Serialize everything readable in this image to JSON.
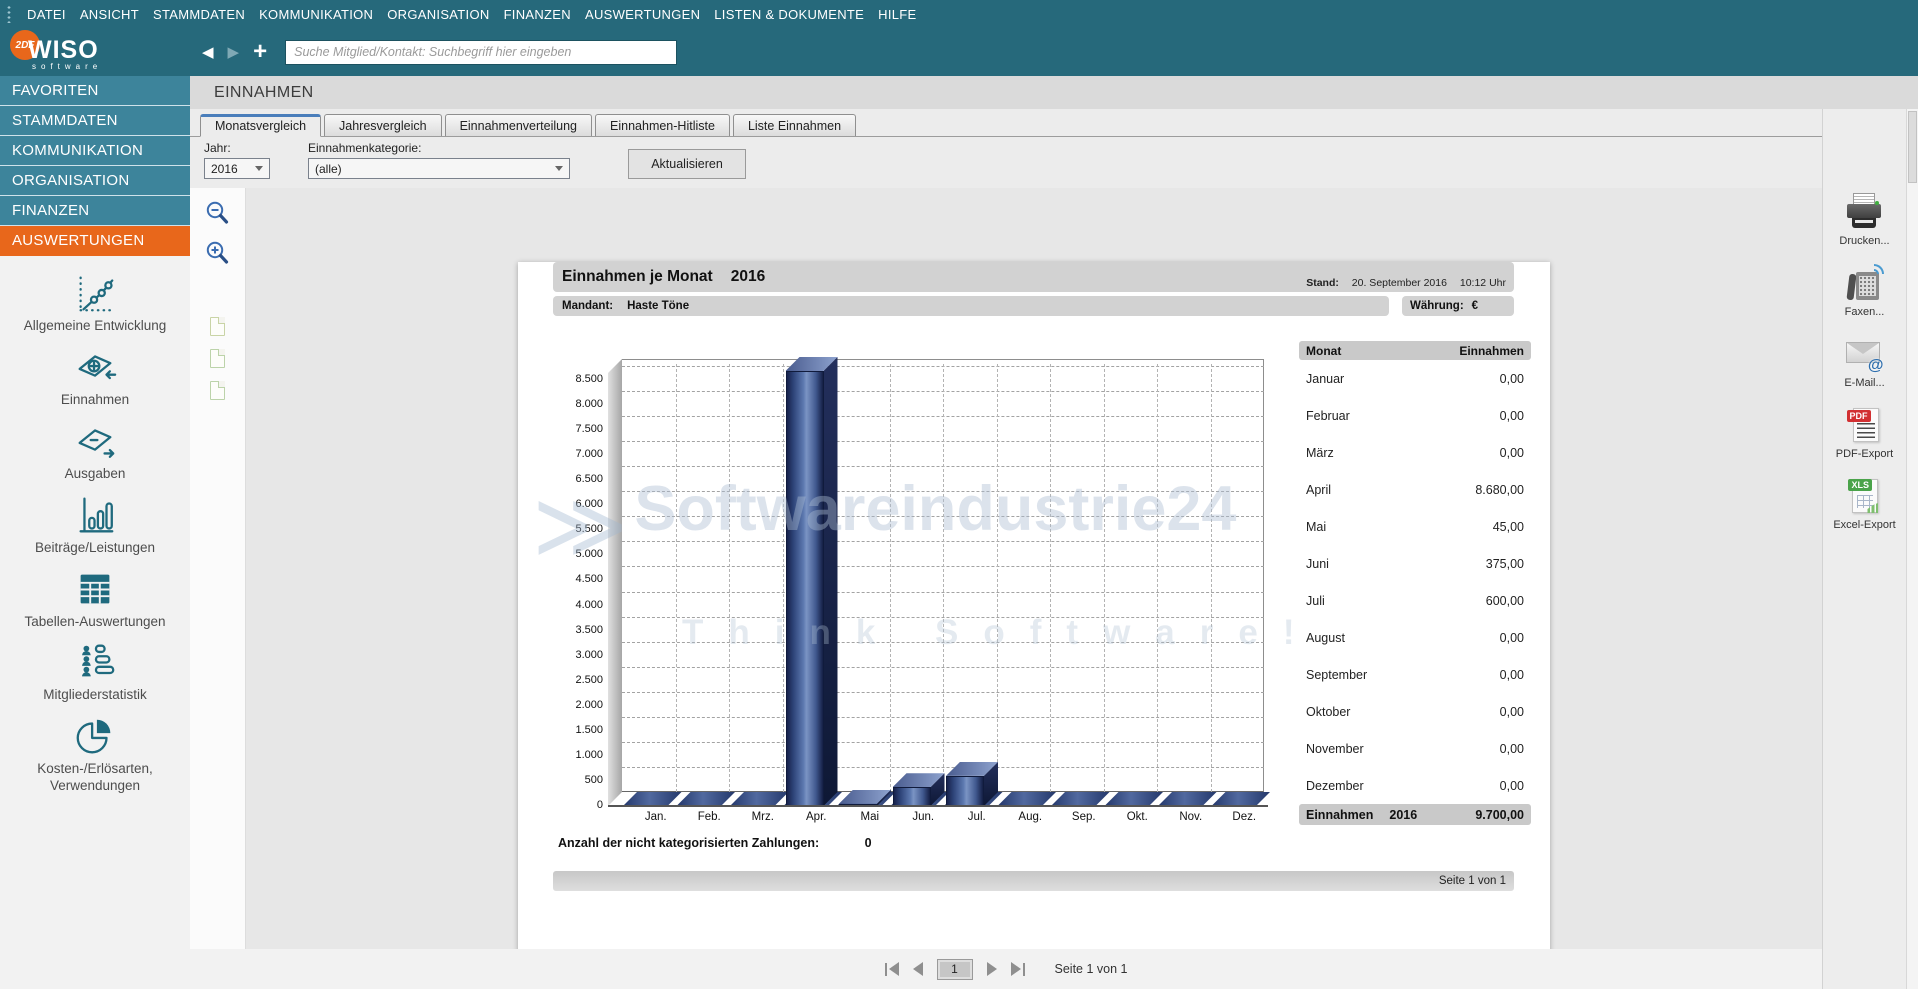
{
  "colors": {
    "menubar_teal": "#26697b",
    "sidebar_teal": "#3d849b",
    "active_nav_orange": "#e8671b",
    "bar_blue": "#2e4a87",
    "tab_accent_blue": "#4a7ebb"
  },
  "menu_bar": {
    "items": [
      "DATEI",
      "ANSICHT",
      "STAMMDATEN",
      "KOMMUNIKATION",
      "ORGANISATION",
      "FINANZEN",
      "AUSWERTUNGEN",
      "LISTEN & DOKUMENTE",
      "HILFE"
    ]
  },
  "toolbar": {
    "logo_badge": "2DF",
    "logo_brand": "WISO",
    "logo_sub": "software",
    "search_placeholder": "Suche Mitglied/Kontakt: Suchbegriff hier eingeben"
  },
  "sidebar": {
    "nav": [
      {
        "label": "FAVORITEN",
        "active": false
      },
      {
        "label": "STAMMDATEN",
        "active": false
      },
      {
        "label": "KOMMUNIKATION",
        "active": false
      },
      {
        "label": "ORGANISATION",
        "active": false
      },
      {
        "label": "FINANZEN",
        "active": false
      },
      {
        "label": "AUSWERTUNGEN",
        "active": true
      }
    ],
    "tools": [
      {
        "label": "Allgemeine Entwicklung",
        "icon": "trend-chart"
      },
      {
        "label": "Einnahmen",
        "icon": "income-note"
      },
      {
        "label": "Ausgaben",
        "icon": "expense-note"
      },
      {
        "label": "Beiträge/Leistungen",
        "icon": "bar-chart"
      },
      {
        "label": "Tabellen-Auswertungen",
        "icon": "table-grid"
      },
      {
        "label": "Mitgliederstatistik",
        "icon": "member-stats"
      },
      {
        "label": "Kosten-/Erlösarten, Verwendungen",
        "icon": "pie-chart"
      }
    ]
  },
  "main": {
    "title": "EINNAHMEN",
    "tabs": [
      {
        "label": "Monatsvergleich",
        "active": true
      },
      {
        "label": "Jahresvergleich",
        "active": false
      },
      {
        "label": "Einnahmenverteilung",
        "active": false
      },
      {
        "label": "Einnahmen-Hitliste",
        "active": false
      },
      {
        "label": "Liste Einnahmen",
        "active": false
      }
    ],
    "filters": {
      "year_label": "Jahr:",
      "year_value": "2016",
      "category_label": "Einnahmenkategorie:",
      "category_value": "(alle)",
      "refresh_label": "Aktualisieren"
    }
  },
  "report": {
    "title_label": "Einnahmen je Monat",
    "title_year": "2016",
    "stand_label": "Stand:",
    "stand_date": "20. September 2016",
    "stand_time": "10:12 Uhr",
    "mandant_label": "Mandant:",
    "mandant_value": "Haste Töne",
    "currency_label": "Währung:",
    "currency_value": "€",
    "note_label": "Anzahl der nicht kategorisierten Zahlungen:",
    "note_value": "0",
    "page_label": "Seite 1 von 1",
    "watermark_text": "Softwareindustrie24",
    "watermark_tagline": "Think Software!",
    "table": {
      "col_month": "Monat",
      "col_income": "Einnahmen",
      "rows": [
        {
          "month": "Januar",
          "value": "0,00"
        },
        {
          "month": "Februar",
          "value": "0,00"
        },
        {
          "month": "März",
          "value": "0,00"
        },
        {
          "month": "April",
          "value": "8.680,00"
        },
        {
          "month": "Mai",
          "value": "45,00"
        },
        {
          "month": "Juni",
          "value": "375,00"
        },
        {
          "month": "Juli",
          "value": "600,00"
        },
        {
          "month": "August",
          "value": "0,00"
        },
        {
          "month": "September",
          "value": "0,00"
        },
        {
          "month": "Oktober",
          "value": "0,00"
        },
        {
          "month": "November",
          "value": "0,00"
        },
        {
          "month": "Dezember",
          "value": "0,00"
        }
      ],
      "total_label": "Einnahmen",
      "total_year": "2016",
      "total_value": "9.700,00"
    }
  },
  "chart_data": {
    "type": "bar",
    "title": "Einnahmen je Monat 2016",
    "categories": [
      "Jan.",
      "Feb.",
      "Mrz.",
      "Apr.",
      "Mai",
      "Jun.",
      "Jul.",
      "Aug.",
      "Sep.",
      "Okt.",
      "Nov.",
      "Dez."
    ],
    "values": [
      0,
      0,
      0,
      8680,
      45,
      375,
      600,
      0,
      0,
      0,
      0,
      0
    ],
    "xlabel": "",
    "ylabel": "",
    "ylim": [
      0,
      9000
    ],
    "ytick_step": 500,
    "ytick_max": 8500,
    "ytick_labels": [
      "0",
      "500",
      "1.000",
      "1.500",
      "2.000",
      "2.500",
      "3.000",
      "3.500",
      "4.000",
      "4.500",
      "5.000",
      "5.500",
      "6.000",
      "6.500",
      "7.000",
      "7.500",
      "8.000",
      "8.500"
    ],
    "grid": true,
    "legend": false,
    "bar_color": "#2e4a87",
    "style": "3d"
  },
  "export_panel": {
    "items": [
      {
        "label": "Drucken...",
        "icon": "printer"
      },
      {
        "label": "Faxen...",
        "icon": "fax"
      },
      {
        "label": "E-Mail...",
        "icon": "email"
      },
      {
        "label": "PDF-Export",
        "icon": "pdf-export",
        "badge": "PDF"
      },
      {
        "label": "Excel-Export",
        "icon": "excel-export",
        "badge": "XLS"
      }
    ]
  },
  "pagination": {
    "page": "1",
    "label": "Seite 1 von 1"
  }
}
